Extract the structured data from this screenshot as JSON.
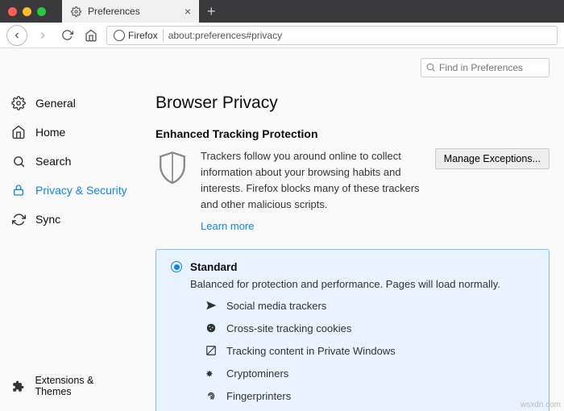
{
  "window": {
    "traffic": [
      "close",
      "minimize",
      "zoom"
    ]
  },
  "tab": {
    "title": "Preferences"
  },
  "urlbar": {
    "brand": "Firefox",
    "url": "about:preferences#privacy"
  },
  "search": {
    "placeholder": "Find in Preferences"
  },
  "sidebar": {
    "items": [
      {
        "icon": "gear-icon",
        "label": "General"
      },
      {
        "icon": "home-icon",
        "label": "Home"
      },
      {
        "icon": "search-icon",
        "label": "Search"
      },
      {
        "icon": "lock-icon",
        "label": "Privacy & Security",
        "active": true
      },
      {
        "icon": "sync-icon",
        "label": "Sync"
      }
    ],
    "bottom": {
      "icon": "puzzle-icon",
      "label": "Extensions & Themes"
    }
  },
  "page": {
    "title": "Browser Privacy",
    "section": "Enhanced Tracking Protection",
    "etp_desc": "Trackers follow you around online to collect information about your browsing habits and interests. Firefox blocks many of these trackers and other malicious scripts.",
    "learn_more": "Learn more",
    "manage_exceptions": "Manage Exceptions...",
    "standard": {
      "label": "Standard",
      "desc": "Balanced for protection and performance. Pages will load normally.",
      "trackers": [
        "Social media trackers",
        "Cross-site tracking cookies",
        "Tracking content in Private Windows",
        "Cryptominers",
        "Fingerprinters"
      ]
    }
  },
  "watermark": "wsxdn.com"
}
